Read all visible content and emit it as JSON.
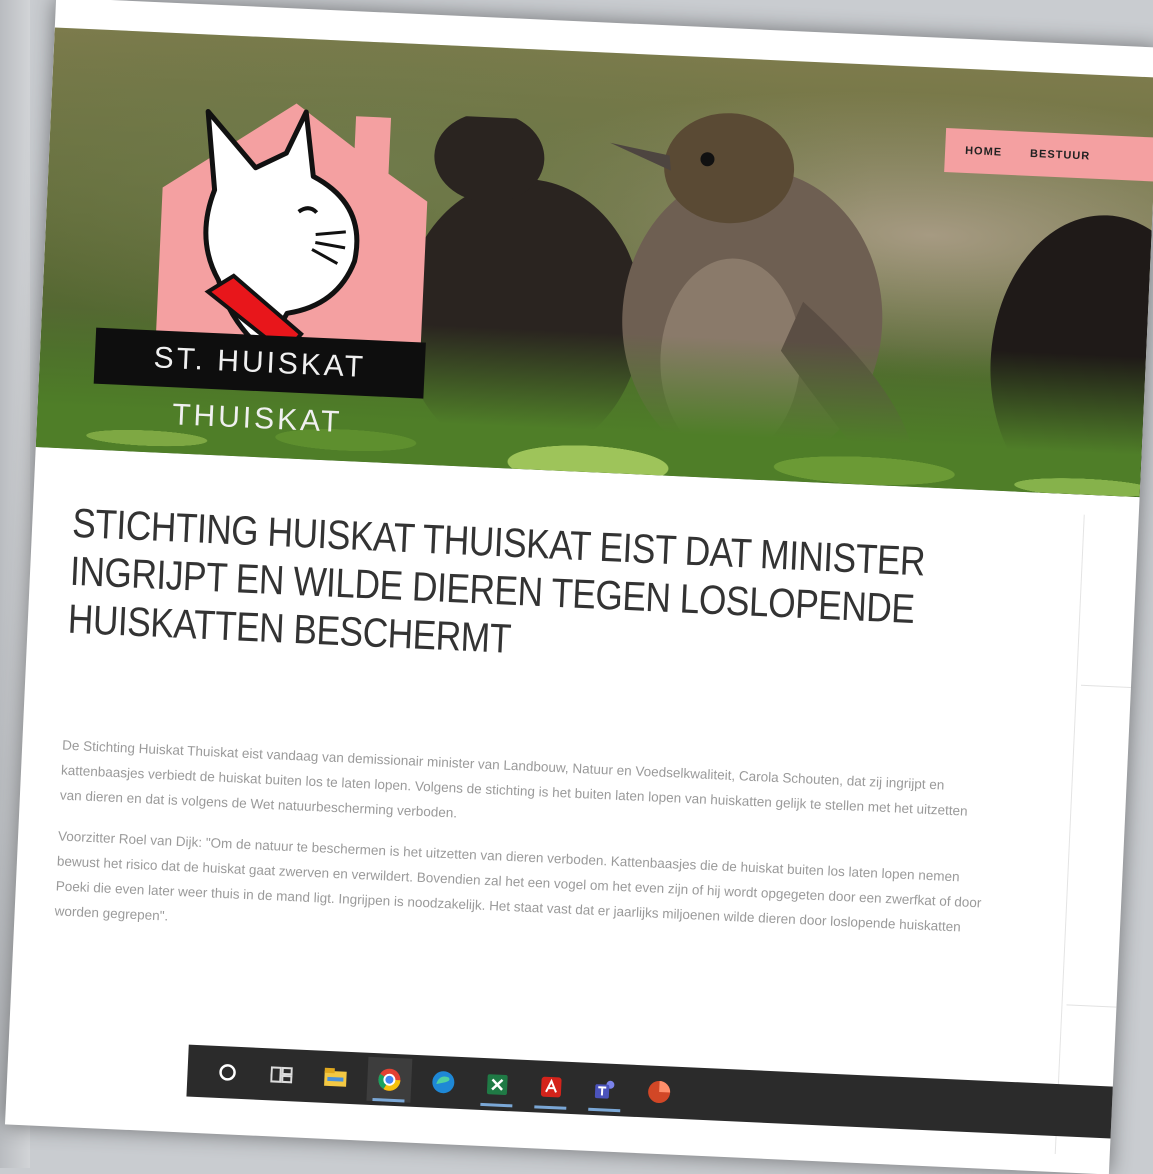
{
  "nav": {
    "items": [
      "HOME",
      "BESTUUR"
    ]
  },
  "logo": {
    "name": "ST. HUISKAT THUISKAT"
  },
  "article": {
    "title": "STICHTING HUISKAT THUISKAT EIST DAT MINISTER INGRIJPT EN WILDE DIEREN TEGEN LOSLOPENDE HUISKATTEN BESCHERMT",
    "paragraphs": [
      "De Stichting Huiskat Thuiskat eist vandaag van demissionair minister van Landbouw, Natuur en Voedselkwaliteit, Carola Schouten, dat zij ingrijpt en kattenbaasjes verbiedt de huiskat buiten los te laten lopen. Volgens de stichting is het buiten laten lopen van huiskatten gelijk te stellen met het uitzetten van dieren en dat is volgens de Wet natuurbescherming verboden.",
      "Voorzitter Roel van Dijk: \"Om de natuur te beschermen is het uitzetten van dieren verboden. Kattenbaasjes die de huiskat buiten los laten lopen nemen bewust het risico dat de huiskat gaat zwerven en verwildert. Bovendien zal het een vogel om het even zijn of hij wordt opgegeten door een zwerfkat of door Poeki die even later weer thuis in de mand ligt. Ingrijpen is noodzakelijk. Het staat vast dat er jaarlijks miljoenen wilde dieren door loslopende huiskatten worden gegrepen\"."
    ]
  },
  "taskbar": {
    "icons": [
      "cortana-circle-icon",
      "task-view-icon",
      "file-explorer-icon",
      "chrome-icon",
      "edge-icon",
      "excel-icon",
      "acrobat-icon",
      "teams-icon",
      "powerpoint-icon"
    ],
    "colors": {
      "brand_pink": "#f4a0a1",
      "taskbar": "#2b2b2b",
      "collar_red": "#e8161b"
    }
  }
}
